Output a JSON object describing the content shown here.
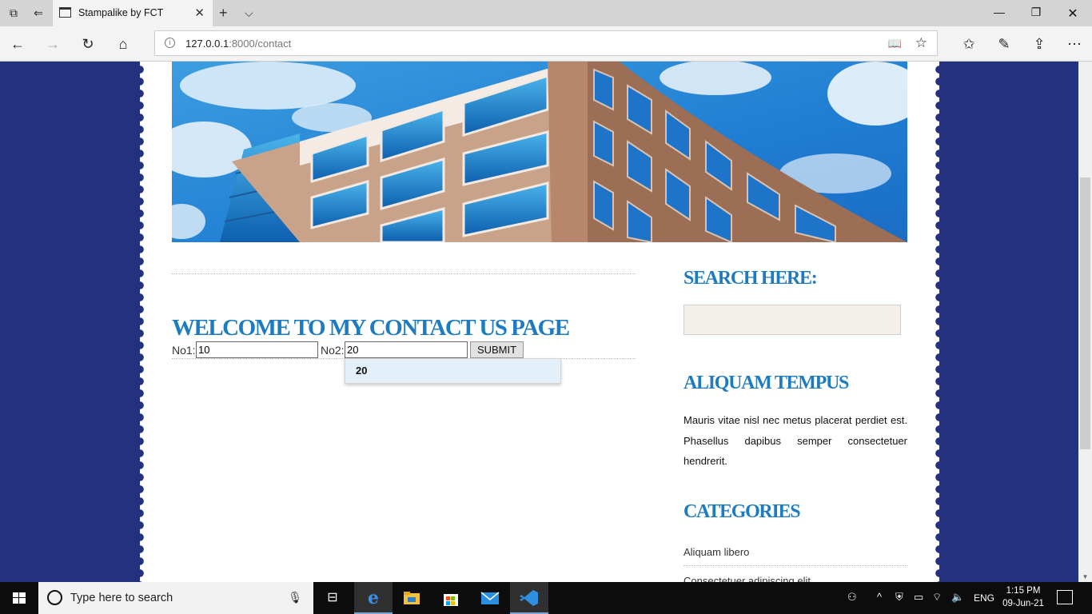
{
  "browser": {
    "tab_title": "Stampalike by FCT",
    "url_host": "127.0.0.1",
    "url_rest": ":8000/contact"
  },
  "page": {
    "main": {
      "title": "WELCOME TO MY CONTACT US PAGE",
      "no1_label": "No1:",
      "no1_value": "10",
      "no2_label": "No2:",
      "no2_value": "20",
      "submit_label": "SUBMIT",
      "autocomplete_option": "20"
    },
    "sidebar": {
      "search_heading": "SEARCH HERE:",
      "tempus_heading": "ALIQUAM TEMPUS",
      "tempus_text": "Mauris vitae nisl nec metus placerat perdiet est. Phasellus dapibus semper consectetuer hendrerit.",
      "categories_heading": "CATEGORIES",
      "categories": [
        "Aliquam libero",
        "Consectetuer adipiscing elit"
      ]
    }
  },
  "taskbar": {
    "search_placeholder": "Type here to search",
    "language": "ENG",
    "time": "1:15 PM",
    "date": "09-Jun-21"
  },
  "colors": {
    "page_background": "#24317e",
    "heading_blue": "#1d7bc1",
    "search_box_fill": "#f3efe9"
  }
}
